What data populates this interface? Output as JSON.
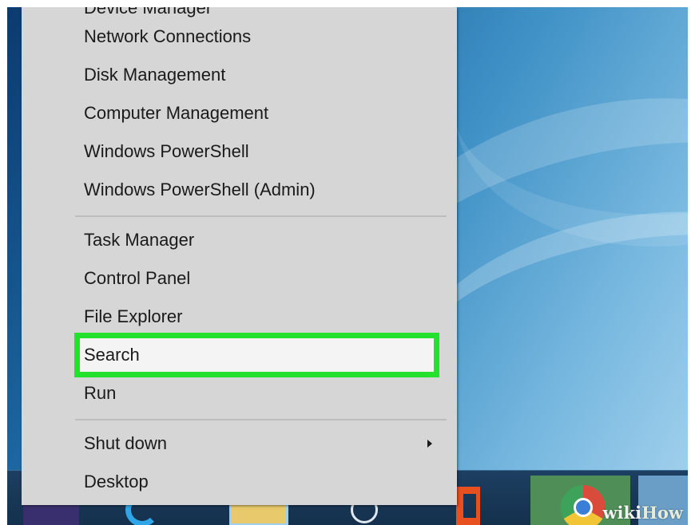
{
  "menu": {
    "items_top": [
      "Device Manager",
      "Network Connections",
      "Disk Management",
      "Computer Management",
      "Windows PowerShell",
      "Windows PowerShell (Admin)"
    ],
    "items_middle": [
      "Task Manager",
      "Control Panel",
      "File Explorer",
      "Search",
      "Run"
    ],
    "items_bottom": [
      "Shut down",
      "Desktop"
    ],
    "highlighted_item": "Search",
    "highlight_color": "#24e12d"
  },
  "taskbar": {
    "icons": [
      "start-icon",
      "internet-explorer-icon",
      "file-explorer-icon",
      "store-icon",
      "office-icon",
      "chrome-icon",
      "app-icon"
    ]
  },
  "watermark": {
    "wiki": "wiki",
    "how": "How"
  }
}
